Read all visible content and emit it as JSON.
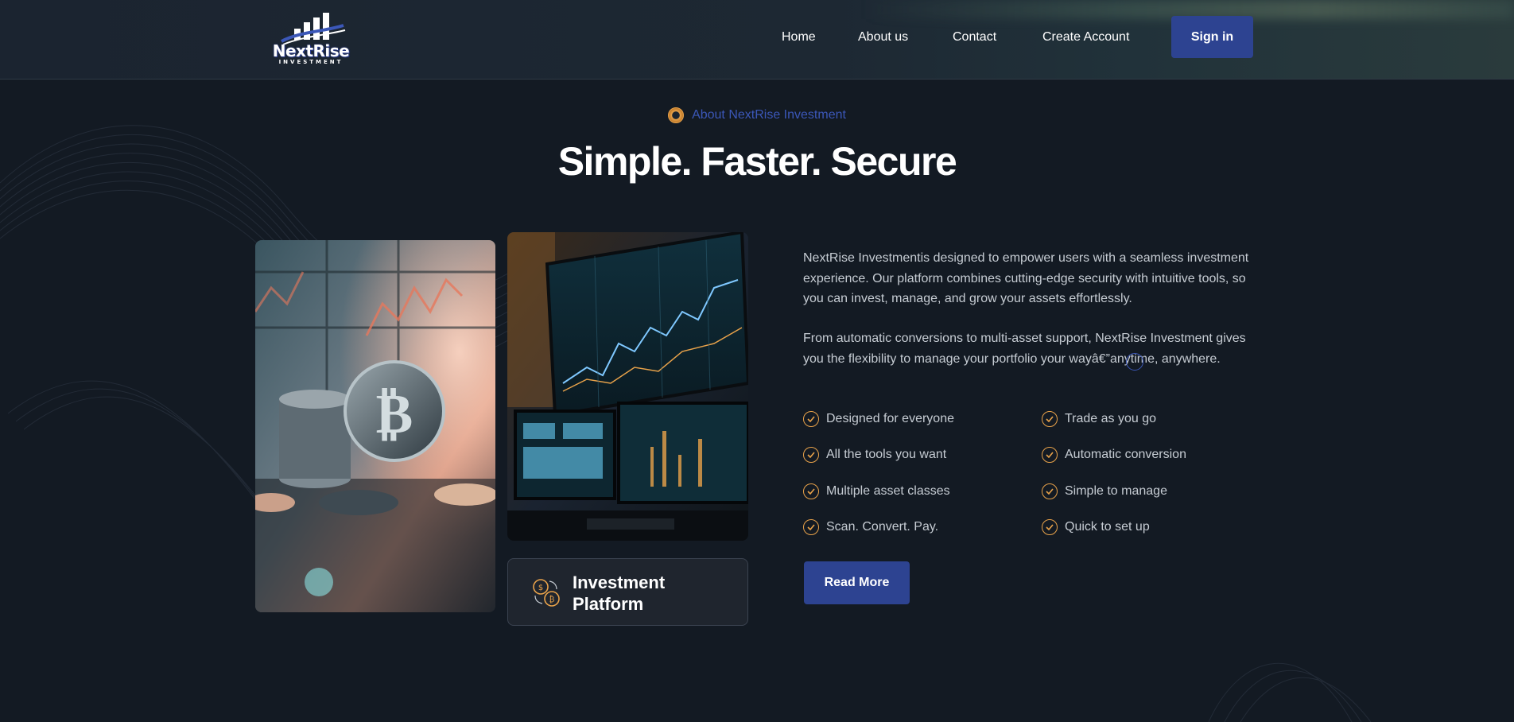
{
  "brand": {
    "name": "NextRise",
    "tagline": "INVESTMENT"
  },
  "nav": {
    "items": [
      "Home",
      "About us",
      "Contact",
      "Create Account"
    ],
    "signin_label": "Sign in"
  },
  "hero": {
    "eyebrow": "About NextRise Investment",
    "title": "Simple. Faster. Secure"
  },
  "platform_card": {
    "title": "Investment Platform",
    "icon": "coin-exchange-icon"
  },
  "about": {
    "paragraph_1": "NextRise Investmentis designed to empower users with a seamless investment experience. Our platform combines cutting-edge security with intuitive tools, so you can invest, manage, and grow your assets effortlessly.",
    "paragraph_2": "From automatic conversions to multi-asset support, NextRise Investment gives you the flexibility to manage your portfolio your wayâ€”anytime, anywhere.",
    "features_left": [
      "Designed for everyone",
      "All the tools you want",
      "Multiple asset classes",
      "Scan. Convert. Pay."
    ],
    "features_right": [
      "Trade as you go",
      "Automatic conversion",
      "Simple to manage",
      "Quick to set up"
    ],
    "cta_label": "Read More"
  },
  "colors": {
    "background": "#131a23",
    "primary": "#2d4391",
    "accent_orange": "#e8a24a",
    "eyebrow_blue": "#3b57b8",
    "body_text": "#c6ccd3"
  },
  "images": {
    "left": "bitcoin-coins-photo",
    "right": "trading-monitors-photo"
  }
}
